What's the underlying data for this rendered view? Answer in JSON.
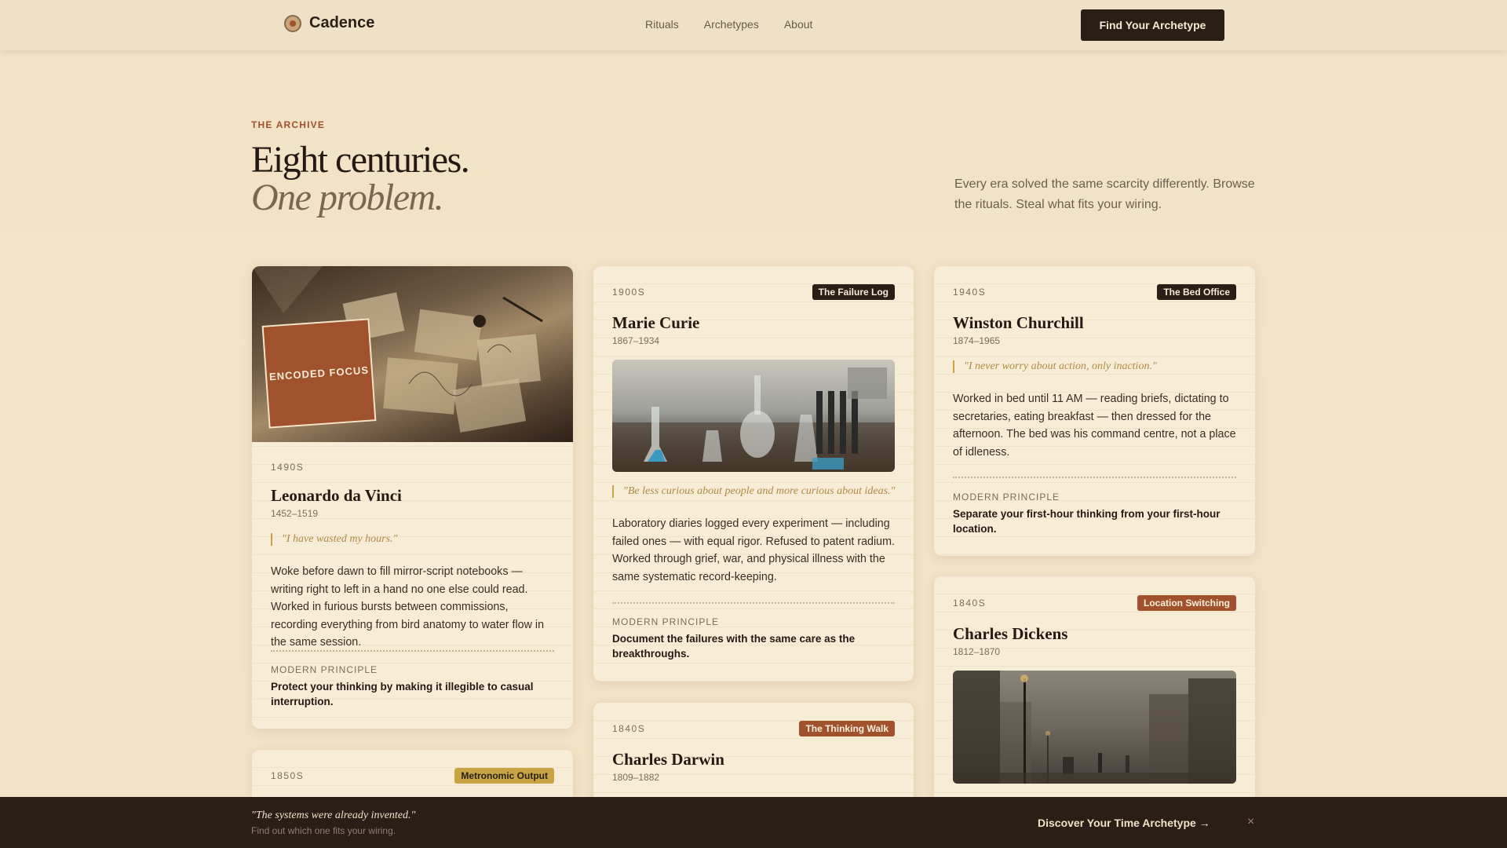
{
  "header": {
    "brand": "Cadence",
    "nav": [
      "Rituals",
      "Archetypes",
      "About"
    ],
    "cta": "Find Your Archetype"
  },
  "hero": {
    "eyebrow": "THE ARCHIVE",
    "title_line1": "Eight centuries.",
    "title_line2": "One problem.",
    "intro": "Every era solved the same scarcity differently. Browse the rituals. Steal what fits your wiring."
  },
  "cards": {
    "davinci": {
      "stamp": "ENCODED FOCUS",
      "era": "1490S",
      "name": "Leonardo da Vinci",
      "years": "1452–1519",
      "quote": "\"I have wasted my hours.\"",
      "body": "Woke before dawn to fill mirror-script notebooks — writing right to left in a hand no one else could read. Worked in furious bursts between commissions, recording everything from bird anatomy to water flow in the same session.",
      "principle_label": "MODERN PRINCIPLE",
      "principle": "Protect your thinking by making it illegible to casual interruption."
    },
    "curie": {
      "era": "1900S",
      "tag": "The Failure Log",
      "name": "Marie Curie",
      "years": "1867–1934",
      "quote": "\"Be less curious about people and more curious about ideas.\"",
      "body": "Laboratory diaries logged every experiment — including failed ones — with equal rigor. Refused to patent radium. Worked through grief, war, and physical illness with the same systematic record-keeping.",
      "principle_label": "MODERN PRINCIPLE",
      "principle": "Document the failures with the same care as the breakthroughs."
    },
    "churchill": {
      "era": "1940S",
      "tag": "The Bed Office",
      "name": "Winston Churchill",
      "years": "1874–1965",
      "quote": "\"I never worry about action, only inaction.\"",
      "body": "Worked in bed until 11 AM — reading briefs, dictating to secretaries, eating breakfast — then dressed for the afternoon. The bed was his command centre, not a place of idleness.",
      "principle_label": "MODERN PRINCIPLE",
      "principle": "Separate your first-hour thinking from your first-hour location."
    },
    "unnamed": {
      "era": "1850S",
      "tag": "Metronomic Output"
    },
    "darwin": {
      "era": "1840S",
      "tag": "The Thinking Walk",
      "name": "Charles Darwin",
      "years": "1809–1882"
    },
    "dickens": {
      "era": "1840S",
      "tag": "Location Switching",
      "name": "Charles Dickens",
      "years": "1812–1870"
    }
  },
  "bottom_bar": {
    "quote": "\"The systems were already invented.\"",
    "sub": "Find out which one fits your wiring.",
    "cta": "Discover Your Time Archetype →",
    "close": "×"
  },
  "colors": {
    "background": "#f3e5c9",
    "ink": "#2a1f17",
    "rust": "#a0522d",
    "gold": "#c8a445"
  }
}
